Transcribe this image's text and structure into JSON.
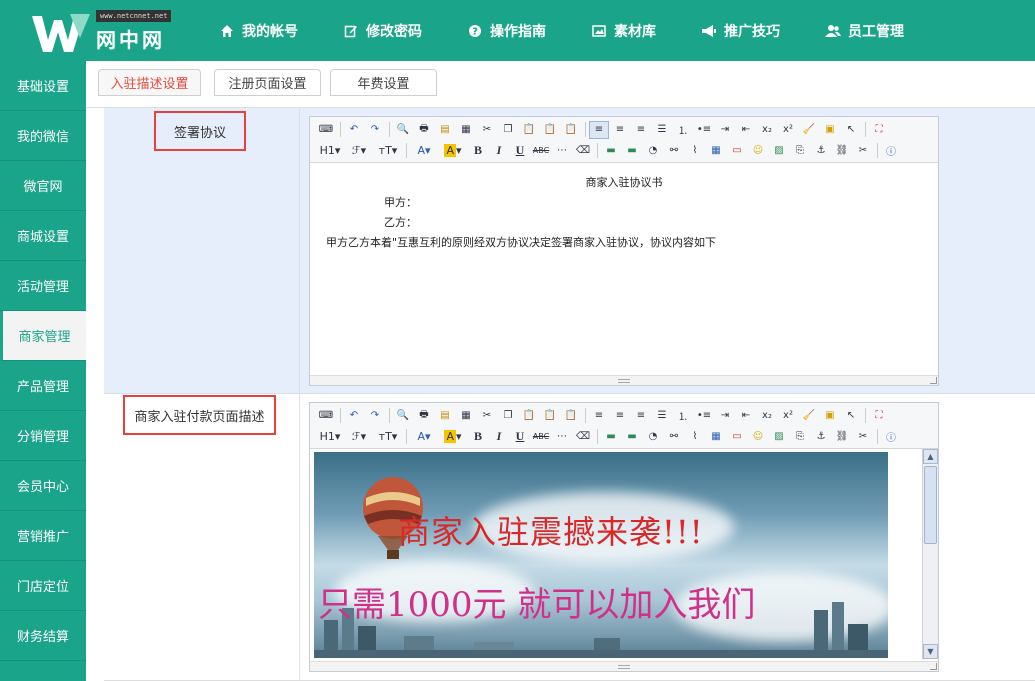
{
  "header": {
    "logo_url": "www.netcnnet.net",
    "logo_text": "网中网",
    "nav": [
      {
        "label": "我的帐号",
        "icon": "home-icon"
      },
      {
        "label": "修改密码",
        "icon": "edit-icon"
      },
      {
        "label": "操作指南",
        "icon": "question-icon"
      },
      {
        "label": "素材库",
        "icon": "image-library-icon"
      },
      {
        "label": "推广技巧",
        "icon": "megaphone-icon"
      },
      {
        "label": "员工管理",
        "icon": "users-icon"
      }
    ]
  },
  "sidebar": {
    "items": [
      {
        "label": "基础设置"
      },
      {
        "label": "我的微信"
      },
      {
        "label": "微官网"
      },
      {
        "label": "商城设置"
      },
      {
        "label": "活动管理"
      },
      {
        "label": "商家管理",
        "active": true
      },
      {
        "label": "产品管理"
      },
      {
        "label": "分销管理"
      },
      {
        "label": "会员中心"
      },
      {
        "label": "营销推广"
      },
      {
        "label": "门店定位"
      },
      {
        "label": "财务结算"
      }
    ]
  },
  "tabs": [
    {
      "label": "入驻描述设置",
      "active": true
    },
    {
      "label": "注册页面设置"
    },
    {
      "label": "年费设置"
    }
  ],
  "form": {
    "agreement": {
      "label": "签署协议",
      "title": "商家入驻协议书",
      "party_a": "甲方：",
      "party_b": "乙方：",
      "body": "甲方乙方本着\"互惠互利的原则经双方协议决定签署商家入驻协议，协议内容如下"
    },
    "payment_page": {
      "label": "商家入驻付款页面描述",
      "banner_line1": "商家入驻震撼来袭!!!",
      "banner_line2": "只需1000元 就可以加入我们"
    }
  },
  "toolbar": {
    "row1": [
      "source",
      "undo",
      "redo",
      "preview",
      "print",
      "template",
      "code",
      "cut",
      "copy",
      "paste",
      "paste-text",
      "paste-word",
      "align-left",
      "align-center",
      "align-right",
      "justify",
      "ordered-list",
      "unordered-list",
      "indent",
      "outdent",
      "subscript",
      "superscript",
      "clear-format",
      "select-all",
      "select",
      "fullscreen"
    ],
    "row2": [
      "H1",
      "F",
      "TT",
      "font-color",
      "highlight",
      "B",
      "I",
      "U",
      "ABC",
      "hr",
      "eraser",
      "image",
      "flash",
      "media",
      "table",
      "insert-row",
      "emoticon",
      "photo",
      "page-break",
      "anchor",
      "link",
      "unlink",
      "about"
    ]
  },
  "colors": {
    "brand": "#1aa58a",
    "active_tab_text": "#e74c3c",
    "highlight_box": "#e8403a",
    "row_bg": "#e5eefa"
  }
}
